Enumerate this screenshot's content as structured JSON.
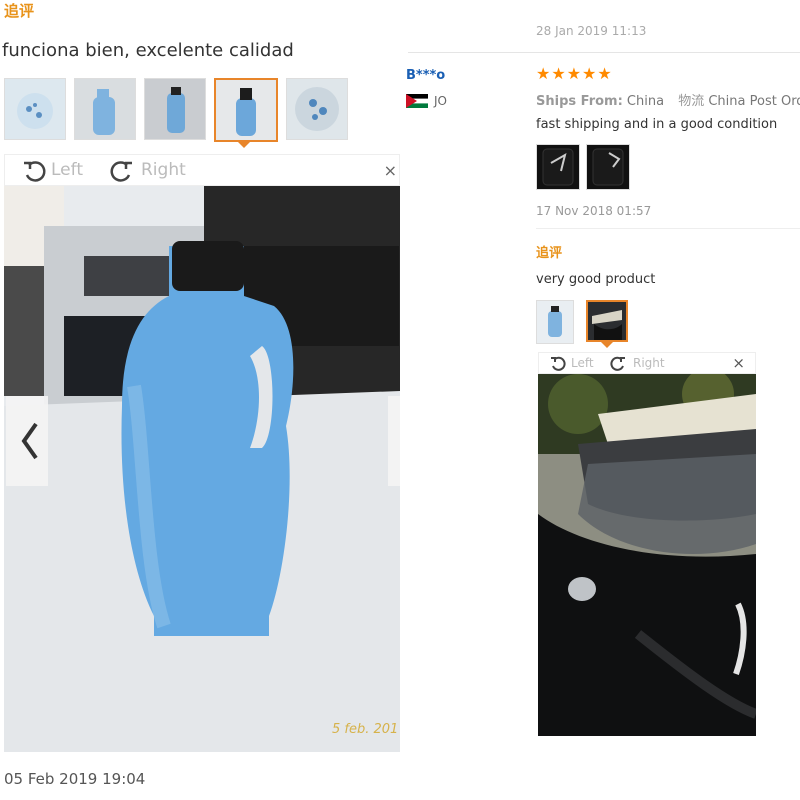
{
  "left": {
    "followup_label": "追评",
    "review_text": "funciona bien, excelente calidad",
    "thumbs": [
      "bottle-top",
      "bottle-side",
      "bottle-hand",
      "bottle-selected",
      "bottle-cap"
    ],
    "rotate_left": "Left",
    "rotate_right": "Right",
    "watermark": "5 feb. 201",
    "date": "05 Feb 2019 19:04"
  },
  "right": {
    "top_date": "28 Jan 2019 11:13",
    "buyer": "B***o",
    "country": "JO",
    "stars": "★★★★★",
    "ships_from_label": "Ships From:",
    "ships_from_value": "China",
    "logistics_label": "物流",
    "logistics_value": "China Post Ord",
    "review_text": "fast shipping and in a good condition",
    "review_date": "17 Nov 2018 01:57",
    "followup_label": "追评",
    "followup_text": "very good product",
    "rotate_left": "Left",
    "rotate_right": "Right",
    "close": "×"
  },
  "colors": {
    "accent": "#e8931b",
    "star": "#ff8a00",
    "link": "#1a5fb4"
  }
}
